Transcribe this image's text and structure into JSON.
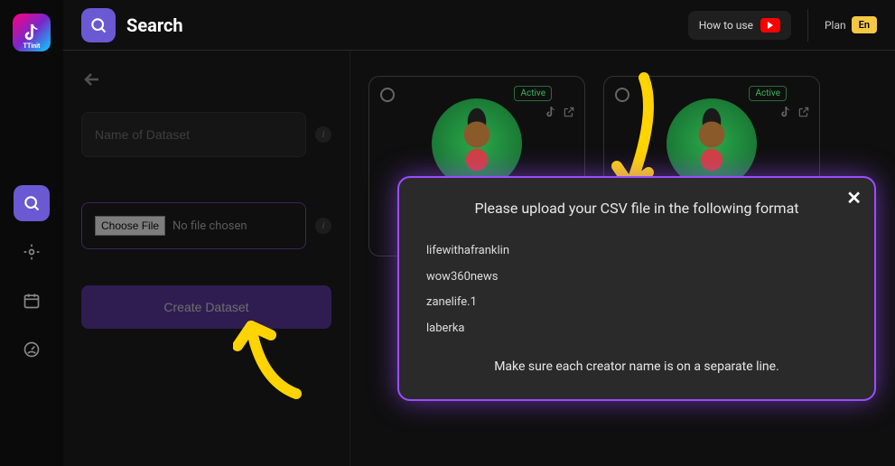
{
  "app": {
    "logo_label": "TTinit"
  },
  "header": {
    "title": "Search",
    "how_to_use": "How to use",
    "plan_label": "Plan",
    "plan_tier": "En"
  },
  "form": {
    "name_placeholder": "Name of Dataset",
    "choose_file_label": "Choose File",
    "no_file_text": "No file chosen",
    "create_label": "Create Dataset"
  },
  "cards": [
    {
      "status": "Active"
    },
    {
      "status": "Active"
    }
  ],
  "popup": {
    "title": "Please upload your CSV file in the following format",
    "examples": [
      "lifewithafranklin",
      "wow360news",
      "zanelife.1",
      "laberka"
    ],
    "note": "Make sure each creator name is on a separate line."
  }
}
